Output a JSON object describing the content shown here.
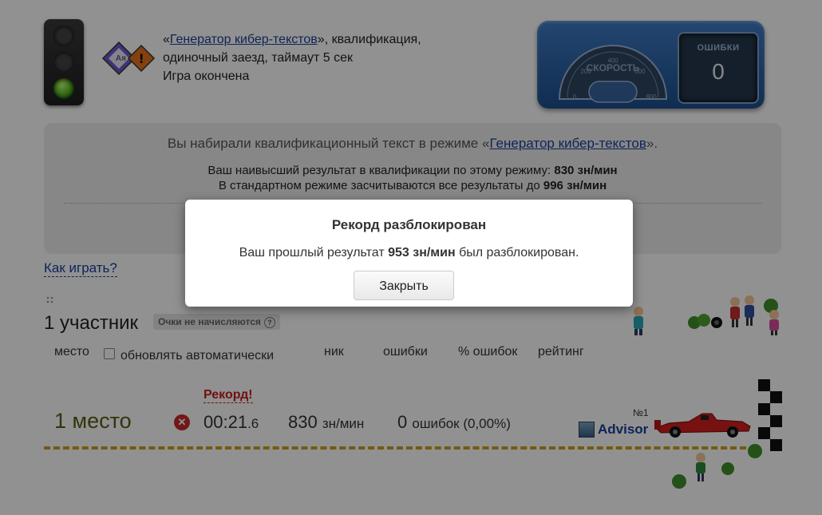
{
  "header": {
    "quote_open": "«",
    "mode_name": "Генератор кибер-текстов",
    "quote_close_rest": "», квалификация,",
    "line2": "одиночный заезд, таймаут 5 сек",
    "status": "Игра окончена"
  },
  "dashboard": {
    "speed_label": "СКОРОСТЬ",
    "ticks": [
      "0",
      "200",
      "400",
      "600",
      "800"
    ],
    "errors_label": "ОШИБКИ",
    "errors_value": "0"
  },
  "info": {
    "line1_pre": "Вы набирали квалификационный текст в режиме «",
    "line1_mode": "Генератор кибер-текстов",
    "line1_post": "».",
    "best_pre": "Ваш наивысший результат в квалификации по этому режиму: ",
    "best_value": "830 зн/мин",
    "std_pre": "В стандартном режиме засчитываются все результаты до ",
    "std_value": "996 зн/мин"
  },
  "howto": "Как играть?",
  "participants": {
    "count_label": "1 участник",
    "badge": "Очки не начисляются",
    "badge_icon": "?"
  },
  "columns": {
    "place": "место",
    "auto_update": "обновлять автоматически",
    "nick": "ник",
    "errors": "ошибки",
    "error_pct": "% ошибок",
    "rating": "рейтинг"
  },
  "result": {
    "record": "Рекорд!",
    "place": "1 место",
    "time_main": "00:21",
    "time_frac": ".6",
    "speed_value": "830",
    "speed_unit": "зн/мин",
    "errors_value": "0",
    "errors_text": "ошибок (0,00",
    "errors_pct": "%)",
    "number": "№1",
    "nick": "Advisor"
  },
  "modal": {
    "title": "Рекорд разблокирован",
    "text_pre": "Ваш прошлый результат ",
    "text_value": "953 зн/мин",
    "text_post": " был разблокирован.",
    "close": "Закрыть"
  },
  "colors": {
    "link": "#1a3f9c",
    "record": "#c71d1d",
    "track": "#c9a017",
    "dashboard": "#2b62a8"
  }
}
